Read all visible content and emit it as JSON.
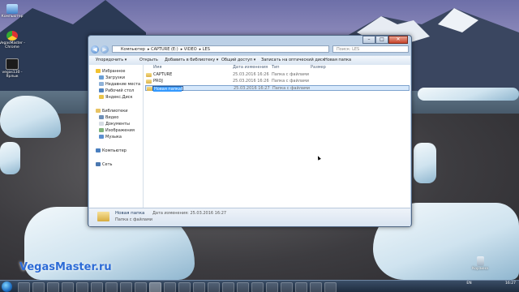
{
  "desktop": {
    "icons": [
      {
        "label": "Компьютер"
      },
      {
        "label": "VegasMaster - Chrome"
      },
      {
        "label": "vegas130 - Ярлык"
      },
      {
        "label": "Корзина"
      }
    ],
    "watermark": "VegasMaster.ru"
  },
  "window": {
    "address": {
      "crumbs": [
        "Компьютер",
        "CAPTURE (E:)",
        "VIDEO",
        "LES"
      ]
    },
    "search_placeholder": "Поиск: LES",
    "toolbar": {
      "organize": "Упорядочить ▾",
      "open": "Открыть",
      "add_library": "Добавить в библиотеку ▾",
      "share": "Общий доступ ▾",
      "burn": "Записать на оптический диск",
      "new_folder": "Новая папка"
    },
    "nav": {
      "favorites": "Избранное",
      "downloads": "Загрузки",
      "recent": "Недавние места",
      "desktop": "Рабочий стол",
      "yandex": "Яндекс.Диск",
      "libraries": "Библиотеки",
      "video": "Видео",
      "documents": "Документы",
      "images": "Изображения",
      "music": "Музыка",
      "computer": "Компьютер",
      "network": "Сеть"
    },
    "columns": {
      "name": "Имя",
      "date": "Дата изменения",
      "type": "Тип",
      "size": "Размер"
    },
    "files": [
      {
        "name": "CAPTURE",
        "date": "25.03.2016 16:26",
        "type": "Папка с файлами"
      },
      {
        "name": "PROJ",
        "date": "25.03.2016 16:26",
        "type": "Папка с файлами"
      },
      {
        "name": "Новая папка",
        "date": "25.03.2016 16:27",
        "type": "Папка с файлами"
      }
    ],
    "details": {
      "name": "Новая папка",
      "modified": "Дата изменения: 25.03.2016 16:27",
      "type": "Папка с файлами"
    }
  },
  "taskbar": {
    "lang": "EN",
    "time": "16:27"
  }
}
